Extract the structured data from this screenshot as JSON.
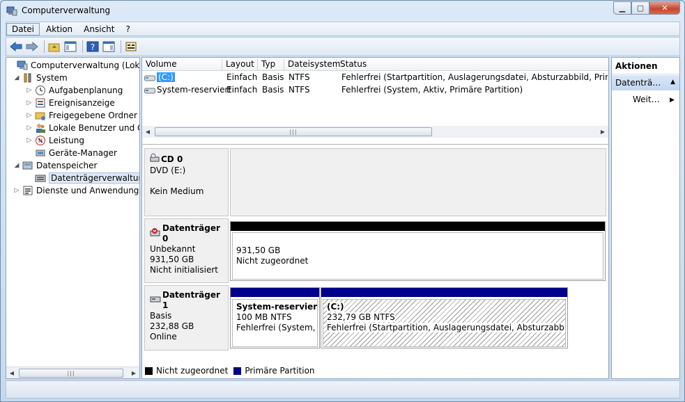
{
  "window": {
    "title": "Computerverwaltung"
  },
  "menu": [
    "Datei",
    "Aktion",
    "Ansicht",
    "?"
  ],
  "tree": {
    "items": [
      {
        "label": "Computerverwaltung (Lokal)",
        "icon": "computer-icon"
      },
      {
        "label": "System",
        "icon": "tools-icon"
      },
      {
        "label": "Aufgabenplanung",
        "icon": "clock-icon"
      },
      {
        "label": "Ereignisanzeige",
        "icon": "event-viewer-icon"
      },
      {
        "label": "Freigegebene Ordner",
        "icon": "shared-folder-icon"
      },
      {
        "label": "Lokale Benutzer und Gruppen",
        "icon": "users-icon"
      },
      {
        "label": "Leistung",
        "icon": "performance-icon"
      },
      {
        "label": "Geräte-Manager",
        "icon": "device-manager-icon"
      },
      {
        "label": "Datenspeicher",
        "icon": "storage-icon"
      },
      {
        "label": "Datenträgerverwaltung",
        "icon": "disk-management-icon"
      },
      {
        "label": "Dienste und Anwendungen",
        "icon": "services-icon"
      }
    ]
  },
  "volumes": {
    "columns": [
      "Volume",
      "Layout",
      "Typ",
      "Dateisystem",
      "Status"
    ],
    "rows": [
      {
        "volume": "(C:)",
        "layout": "Einfach",
        "typ": "Basis",
        "fs": "NTFS",
        "status": "Fehlerfrei (Startpartition, Auslagerungsdatei, Absturzabbild, Primäre Partition)"
      },
      {
        "volume": "System-reserviert",
        "layout": "Einfach",
        "typ": "Basis",
        "fs": "NTFS",
        "status": "Fehlerfrei (System, Aktiv, Primäre Partition)"
      }
    ]
  },
  "disks": {
    "cd0": {
      "name": "CD 0",
      "type": "DVD (E:)",
      "state": "Kein Medium"
    },
    "disk0": {
      "name": "Datenträger 0",
      "type": "Unbekannt",
      "size": "931,50 GB",
      "state": "Nicht initialisiert",
      "part_size": "931,50 GB",
      "part_label": "Nicht zugeordnet"
    },
    "disk1": {
      "name": "Datenträger 1",
      "type": "Basis",
      "size": "232,88 GB",
      "state": "Online",
      "p1": {
        "name": "System-reserviert",
        "size": "100 MB NTFS",
        "status": "Fehlerfrei (System, Aktiv, Primäre Partition)"
      },
      "p2": {
        "name": "(C:)",
        "size": "232,79 GB NTFS",
        "status": "Fehlerfrei (Startpartition, Auslagerungsdatei, Absturzabbild, Primäre Partition)"
      }
    }
  },
  "legend": {
    "unallocated": "Nicht zugeordnet",
    "primary": "Primäre Partition"
  },
  "actions": {
    "title": "Aktionen",
    "section": "Datenträgerverwaltung",
    "more": "Weitere Aktionen"
  },
  "colors": {
    "unallocated": "#000000",
    "primary": "#00008b",
    "selection": "#3399ff"
  }
}
